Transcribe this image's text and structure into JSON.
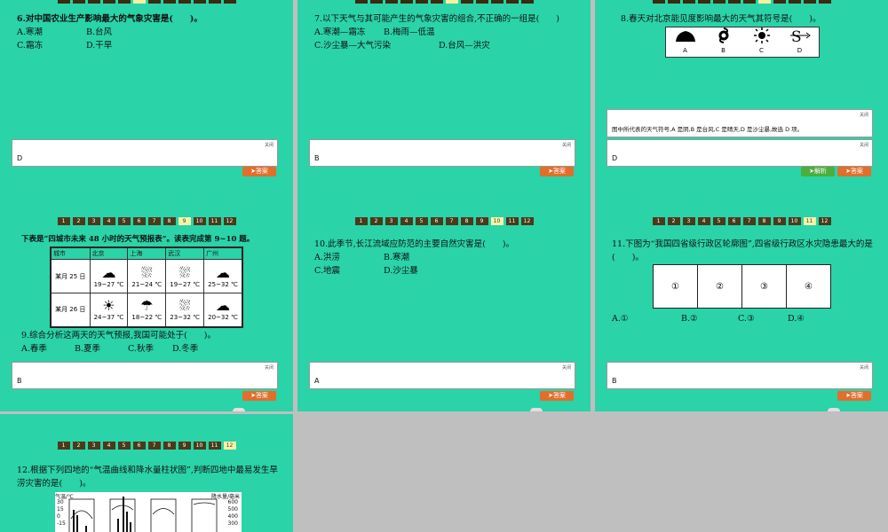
{
  "slide_top": {
    "q6": {
      "title": "6.对中国农业生产影响最大的气象灾害是(　　)。",
      "options": [
        "A.寒潮",
        "B.台风",
        "C.霜冻",
        "D.干旱"
      ],
      "close": "关闭",
      "answer": "D",
      "answer_btn": "答案"
    },
    "q7": {
      "title": "7.以下天气与其可能产生的气象灾害的组合,不正确的一组是(　　)",
      "options": [
        "A.寒潮—霜冻",
        "B.梅雨—低温",
        "C.沙尘暴—大气污染",
        "D.台风—洪灾"
      ],
      "close": "关闭",
      "answer": "B",
      "answer_btn": "答案"
    },
    "q8": {
      "title": "8.春天对北京能见度影响最大的天气其符号是(　　)。",
      "symbols": [
        "A",
        "B",
        "C",
        "D"
      ],
      "close1": "关闭",
      "explain_text": "图中所代表的天气符号,A 是阴,B 是台风,C 是晴天,D 是沙尘暴,故选 D 项。",
      "close": "关闭",
      "answer": "D",
      "explain_btn": "解析",
      "answer_btn": "答案"
    }
  },
  "slide_mid": {
    "nav": [
      "1",
      "2",
      "3",
      "4",
      "5",
      "6",
      "7",
      "8",
      "9",
      "10",
      "11",
      "12"
    ],
    "q9": {
      "intro": "下表是“四城市未来 48 小时的天气预报表”。读表完成第 9~10 题。",
      "table_header": [
        "城市",
        "北京",
        "上海",
        "武汉",
        "广州"
      ],
      "row1": {
        "label": "某月 25 日",
        "temps": [
          "19~27 ℃",
          "21~24 ℃",
          "19~27 ℃",
          "25~32 ℃"
        ]
      },
      "row2": {
        "label": "某月 26 日",
        "temps": [
          "24~37 ℃",
          "18~22 ℃",
          "23~32 ℃",
          "20~32 ℃"
        ]
      },
      "title": "9.综合分析这两天的天气预报,我国可能处于(　　)。",
      "options": [
        "A.春季",
        "B.夏季",
        "C.秋季",
        "D.冬季"
      ],
      "close": "关闭",
      "answer": "B",
      "answer_btn": "答案"
    },
    "q10": {
      "title": "10.此季节,长江流域应防范的主要自然灾害是(　　)。",
      "options": [
        "A.洪涝",
        "B.寒潮",
        "C.地震",
        "D.沙尘暴"
      ],
      "close": "关闭",
      "answer": "A",
      "answer_btn": "答案"
    },
    "q11": {
      "title": "11.下图为“我国四省级行政区轮廓图”,四省级行政区水灾隐患最大的是(　　)。",
      "maps": [
        "①",
        "②",
        "③",
        "④"
      ],
      "options": [
        "A.①",
        "B.②",
        "C.③",
        "D.④"
      ],
      "close": "关闭",
      "answer": "B",
      "answer_btn": "答案"
    }
  },
  "slide_bottom": {
    "q12": {
      "title": "12.根据下列四地的“气温曲线和降水量柱状图”,判断四地中最易发生旱涝灾害的是(　　)。",
      "ylabel_left": "气温/℃",
      "ylabel_right": "降水量/毫米",
      "left_ticks": [
        "30",
        "15",
        "0",
        "-15"
      ],
      "right_ticks": [
        "600",
        "500",
        "400",
        "300"
      ]
    }
  }
}
